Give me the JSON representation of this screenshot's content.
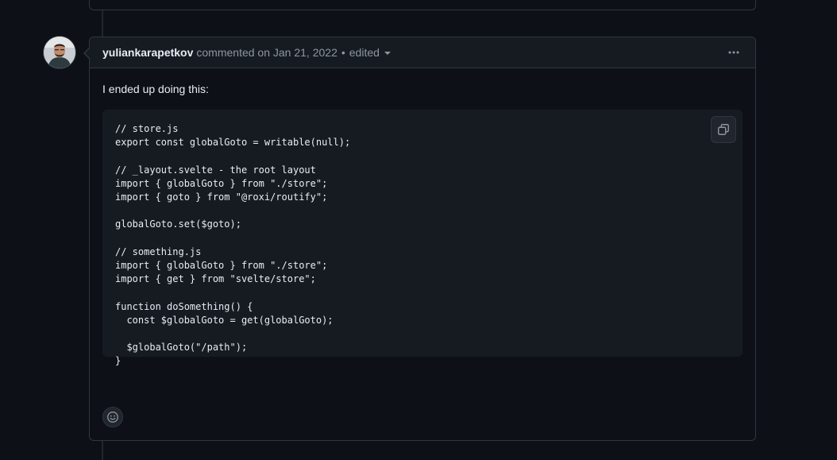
{
  "comment": {
    "author": "yuliankarapetkov",
    "action_text": "commented on",
    "date": "Jan 21, 2022",
    "separator": "•",
    "edited_label": "edited",
    "body_text": "I ended up doing this:",
    "code": "// store.js\nexport const globalGoto = writable(null);\n\n// _layout.svelte - the root layout\nimport { globalGoto } from \"./store\";\nimport { goto } from \"@roxi/routify\";\n\nglobalGoto.set($goto);\n\n// something.js\nimport { globalGoto } from \"./store\";\nimport { get } from \"svelte/store\";\n\nfunction doSomething() {\n  const $globalGoto = get(globalGoto);\n\n  $globalGoto(\"/path\");\n}"
  },
  "icons": {
    "kebab": "kebab-horizontal-icon",
    "copy": "copy-icon",
    "reaction": "smiley-icon",
    "caret": "triangle-down-icon"
  },
  "colors": {
    "background": "#0d1117",
    "header_bg": "#161b22",
    "border": "#30363d",
    "muted_text": "#8d96a0",
    "text": "#e6edf3"
  }
}
